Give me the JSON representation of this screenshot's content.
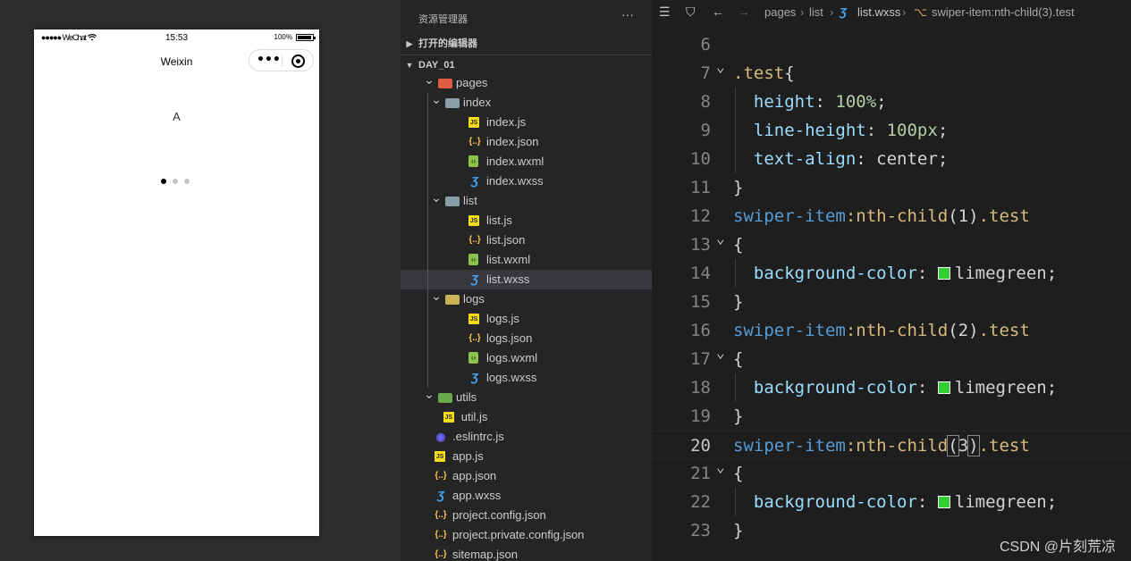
{
  "simulator": {
    "carrier": "●●●●● WeChat",
    "wifi_icon": "wifi-icon",
    "time": "15:53",
    "battery_percent": "100%",
    "nav_title": "Weixin",
    "swiper_text": "A",
    "swiper_dots": {
      "count": 3,
      "active_index": 0
    }
  },
  "explorer": {
    "title": "资源管理器",
    "more": "···",
    "open_editors": "打开的编辑器",
    "project": "DAY_01",
    "tree": [
      {
        "name": "pages",
        "type": "folder-pages",
        "depth": 1,
        "expanded": true
      },
      {
        "name": "index",
        "type": "folder-plain",
        "depth": 2,
        "expanded": true
      },
      {
        "name": "index.js",
        "type": "js",
        "depth": 3
      },
      {
        "name": "index.json",
        "type": "json",
        "depth": 3
      },
      {
        "name": "index.wxml",
        "type": "wxml",
        "depth": 3
      },
      {
        "name": "index.wxss",
        "type": "wxss",
        "depth": 3
      },
      {
        "name": "list",
        "type": "folder-plain",
        "depth": 2,
        "expanded": true
      },
      {
        "name": "list.js",
        "type": "js",
        "depth": 3
      },
      {
        "name": "list.json",
        "type": "json",
        "depth": 3
      },
      {
        "name": "list.wxml",
        "type": "wxml",
        "depth": 3
      },
      {
        "name": "list.wxss",
        "type": "wxss",
        "depth": 3,
        "selected": true
      },
      {
        "name": "logs",
        "type": "folder-logs",
        "depth": 2,
        "expanded": true
      },
      {
        "name": "logs.js",
        "type": "js",
        "depth": 3
      },
      {
        "name": "logs.json",
        "type": "json",
        "depth": 3
      },
      {
        "name": "logs.wxml",
        "type": "wxml",
        "depth": 3
      },
      {
        "name": "logs.wxss",
        "type": "wxss",
        "depth": 3
      },
      {
        "name": "utils",
        "type": "folder-utils",
        "depth": 1,
        "expanded": true
      },
      {
        "name": "util.js",
        "type": "js",
        "depth": 2.6
      },
      {
        "name": ".eslintrc.js",
        "type": "eslint",
        "depth": 1.5
      },
      {
        "name": "app.js",
        "type": "js",
        "depth": 1.5
      },
      {
        "name": "app.json",
        "type": "json",
        "depth": 1.5
      },
      {
        "name": "app.wxss",
        "type": "wxss",
        "depth": 1.5
      },
      {
        "name": "project.config.json",
        "type": "json",
        "depth": 1.5
      },
      {
        "name": "project.private.config.json",
        "type": "json",
        "depth": 1.5
      },
      {
        "name": "sitemap.json",
        "type": "json",
        "depth": 1.5
      }
    ]
  },
  "editor": {
    "breadcrumb": {
      "parts": [
        "pages",
        "list",
        "list.wxss",
        "swiper-item:nth-child(3).test"
      ]
    },
    "current_line": 20,
    "lines": [
      {
        "n": 6,
        "tokens": []
      },
      {
        "n": 7,
        "fold": true,
        "tokens": [
          [
            "t-sel",
            ".test"
          ],
          [
            "t-punc",
            "{"
          ]
        ]
      },
      {
        "n": 8,
        "indent": true,
        "tokens": [
          [
            "t-prop",
            "  height"
          ],
          [
            "t-punc",
            ": "
          ],
          [
            "t-num",
            "100%"
          ],
          [
            "t-punc",
            ";"
          ]
        ]
      },
      {
        "n": 9,
        "indent": true,
        "tokens": [
          [
            "t-prop",
            "  line-height"
          ],
          [
            "t-punc",
            ": "
          ],
          [
            "t-num",
            "100px"
          ],
          [
            "t-punc",
            ";"
          ]
        ]
      },
      {
        "n": 10,
        "indent": true,
        "tokens": [
          [
            "t-prop",
            "  text-align"
          ],
          [
            "t-punc",
            ": "
          ],
          [
            "t-val",
            "center"
          ],
          [
            "t-punc",
            ";"
          ]
        ]
      },
      {
        "n": 11,
        "tokens": [
          [
            "t-punc",
            "}"
          ]
        ]
      },
      {
        "n": 12,
        "tokens": [
          [
            "t-tag",
            "swiper-item"
          ],
          [
            "t-pseudo",
            ":nth-child"
          ],
          [
            "t-punc",
            "(1)"
          ],
          [
            "t-sel",
            ".test"
          ]
        ]
      },
      {
        "n": 13,
        "fold": true,
        "tokens": [
          [
            "t-punc",
            "{"
          ]
        ]
      },
      {
        "n": 14,
        "indent": true,
        "swatch": "#32cd32",
        "tokens": [
          [
            "t-prop",
            "  background-color"
          ],
          [
            "t-punc",
            ": "
          ],
          [
            "swatch",
            ""
          ],
          [
            "t-val",
            "limegreen"
          ],
          [
            "t-punc",
            ";"
          ]
        ]
      },
      {
        "n": 15,
        "tokens": [
          [
            "t-punc",
            "}"
          ]
        ]
      },
      {
        "n": 16,
        "tokens": [
          [
            "t-tag",
            "swiper-item"
          ],
          [
            "t-pseudo",
            ":nth-child"
          ],
          [
            "t-punc",
            "(2)"
          ],
          [
            "t-sel",
            ".test"
          ]
        ]
      },
      {
        "n": 17,
        "fold": true,
        "tokens": [
          [
            "t-punc",
            "{"
          ]
        ]
      },
      {
        "n": 18,
        "indent": true,
        "swatch": "#32cd32",
        "tokens": [
          [
            "t-prop",
            "  background-color"
          ],
          [
            "t-punc",
            ": "
          ],
          [
            "swatch",
            ""
          ],
          [
            "t-val",
            "limegreen"
          ],
          [
            "t-punc",
            ";"
          ]
        ]
      },
      {
        "n": 19,
        "tokens": [
          [
            "t-punc",
            "}"
          ]
        ]
      },
      {
        "n": 20,
        "tokens": [
          [
            "t-tag",
            "swiper-item"
          ],
          [
            "t-pseudo",
            ":nth-child"
          ],
          [
            "bracket",
            "("
          ],
          [
            "t-punc",
            "3"
          ],
          [
            "bracket",
            ")"
          ],
          [
            "t-sel",
            ".test"
          ]
        ]
      },
      {
        "n": 21,
        "fold": true,
        "tokens": [
          [
            "t-punc",
            "{"
          ]
        ]
      },
      {
        "n": 22,
        "indent": true,
        "swatch": "#32cd32",
        "tokens": [
          [
            "t-prop",
            "  background-color"
          ],
          [
            "t-punc",
            ": "
          ],
          [
            "swatch",
            ""
          ],
          [
            "t-val",
            "limegreen"
          ],
          [
            "t-punc",
            ";"
          ]
        ]
      },
      {
        "n": 23,
        "tokens": [
          [
            "t-punc",
            "}"
          ]
        ]
      }
    ]
  },
  "watermark": "CSDN @片刻荒凉",
  "colors": {
    "swatch": "#32cd32",
    "selector": "#d7ba7d",
    "tag": "#569cd6",
    "property": "#9cdcfe",
    "number": "#b5cea8"
  }
}
